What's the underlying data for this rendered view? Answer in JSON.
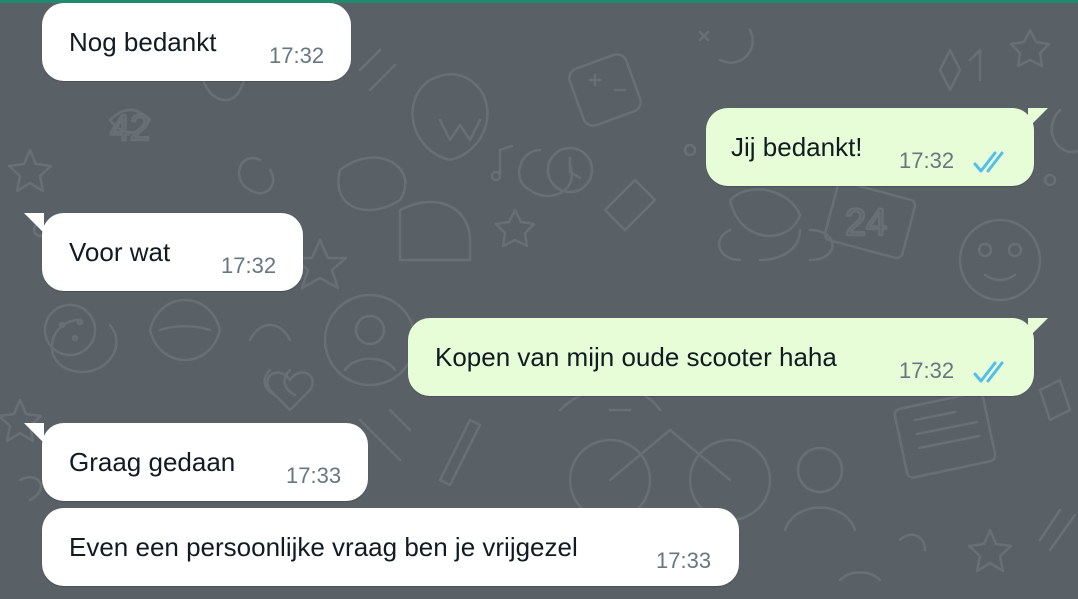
{
  "chat": {
    "messages": [
      {
        "direction": "incoming",
        "text": "Nog bedankt",
        "time": "17:32"
      },
      {
        "direction": "outgoing",
        "text": "Jij bedankt!",
        "time": "17:32",
        "status_icon": "double-check-read-icon"
      },
      {
        "direction": "incoming",
        "text": "Voor wat",
        "time": "17:32"
      },
      {
        "direction": "outgoing",
        "text": "Kopen van mijn oude scooter haha",
        "time": "17:32",
        "status_icon": "double-check-read-icon"
      },
      {
        "direction": "incoming",
        "text": "Graag gedaan",
        "time": "17:33"
      },
      {
        "direction": "incoming",
        "text": "Even een persoonlijke vraag ben je vrijgezel",
        "time": "17:33"
      }
    ]
  },
  "colors": {
    "background": "#5a6166",
    "incoming_bubble": "#ffffff",
    "outgoing_bubble": "#e7fdd8",
    "read_ticks": "#53bdeb",
    "text": "#111b21",
    "time": "#667781"
  }
}
